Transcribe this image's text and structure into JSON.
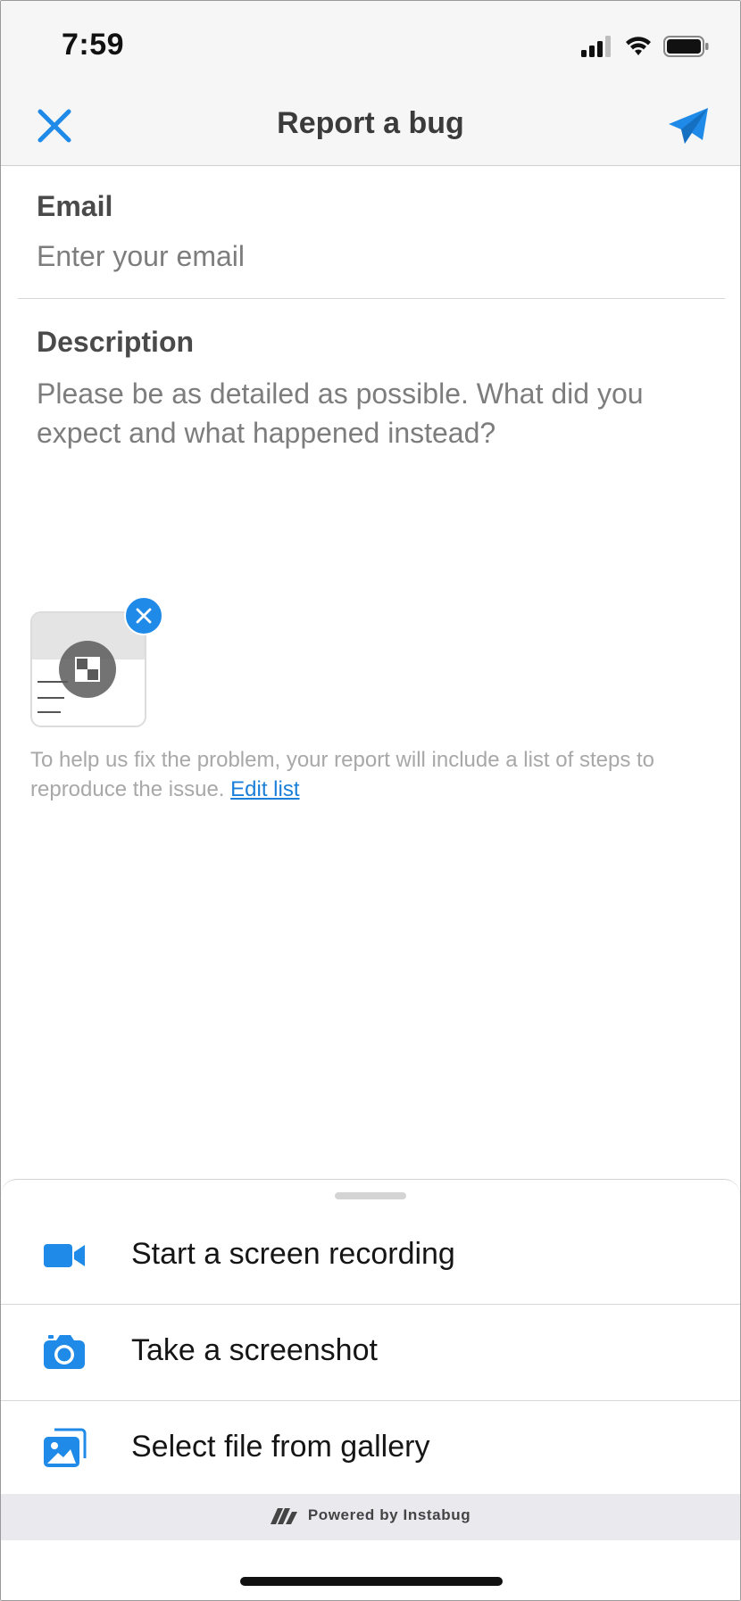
{
  "status_bar": {
    "time": "7:59"
  },
  "header": {
    "title": "Report a bug"
  },
  "form": {
    "email_label": "Email",
    "email_placeholder": "Enter your email",
    "email_value": "",
    "description_label": "Description",
    "description_placeholder": "Please be as detailed as possible. What did you expect and what happened instead?",
    "description_value": ""
  },
  "help": {
    "text": "To help us fix the problem, your report will include a list of steps to reproduce the issue.",
    "link": "Edit list"
  },
  "attachment": {
    "type": "screenshot-thumbnail"
  },
  "sheet": {
    "items": [
      {
        "label": "Start a screen recording",
        "icon": "video-camera-icon"
      },
      {
        "label": "Take a screenshot",
        "icon": "camera-icon"
      },
      {
        "label": "Select file from gallery",
        "icon": "gallery-icon"
      }
    ]
  },
  "footer": {
    "powered_by": "Powered by Instabug"
  },
  "colors": {
    "accent": "#1f8ae8",
    "link": "#1a7fd9",
    "muted": "#a8a8a8"
  }
}
